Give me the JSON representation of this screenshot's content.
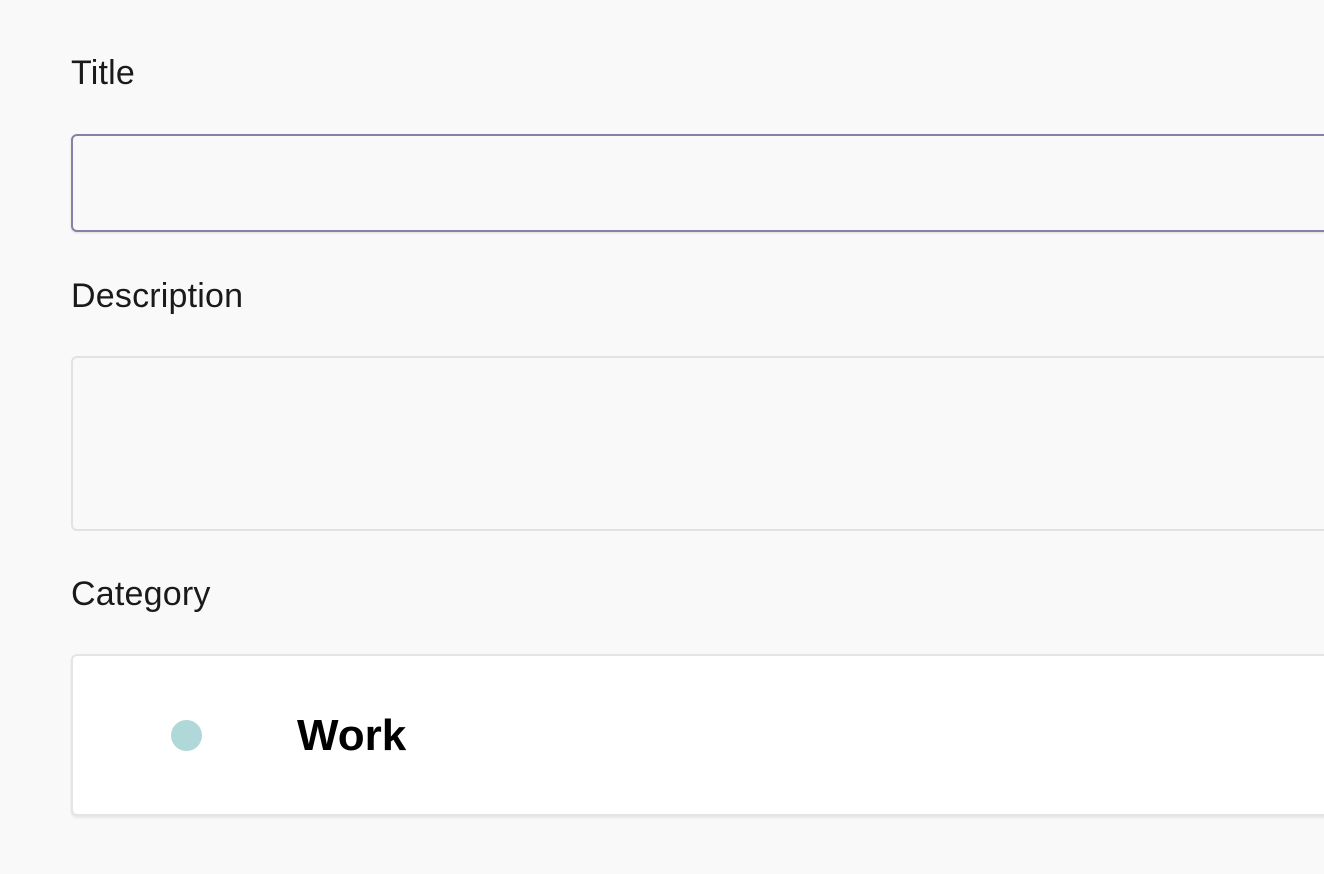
{
  "form": {
    "title_label": "Title",
    "title_value": "",
    "description_label": "Description",
    "description_value": "",
    "category_label": "Category",
    "category": {
      "selected": "Work",
      "dot_color": "#b1d8d9"
    }
  },
  "colors": {
    "background": "#f9f9f9",
    "focus_border": "#8a7fa6",
    "input_border": "#e2e2e2"
  }
}
